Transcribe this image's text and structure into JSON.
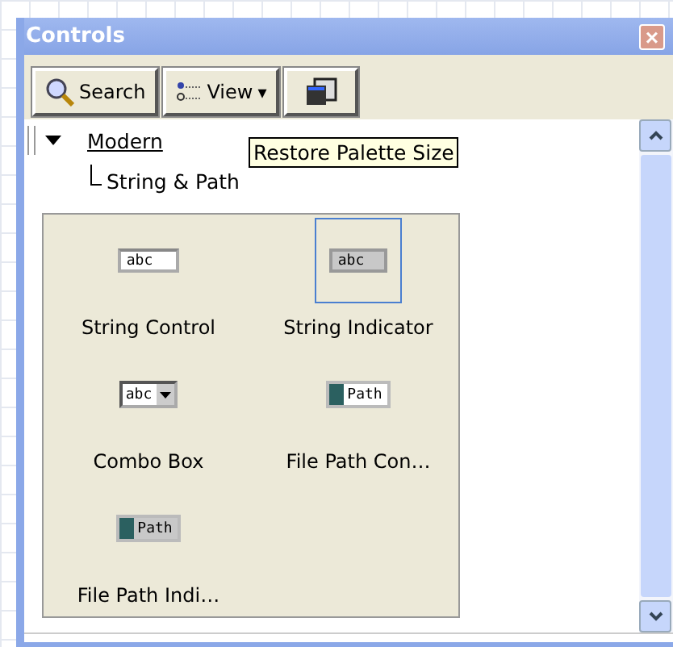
{
  "window": {
    "title": "Controls",
    "close": "×"
  },
  "toolbar": [
    {
      "kind": "search",
      "label": "Search"
    },
    {
      "kind": "view",
      "label": "View",
      "caret": "▾"
    },
    {
      "kind": "restore"
    }
  ],
  "tooltip": "Restore Palette Size",
  "tree": [
    {
      "label": "Modern",
      "expanded": true,
      "children": [
        {
          "label": "String & Path"
        }
      ]
    }
  ],
  "palette": [
    {
      "label": "String Control",
      "kind": "string-control",
      "icon_text": "abc",
      "selected": false
    },
    {
      "label": "String Indicator",
      "kind": "string-indicator",
      "icon_text": "abc",
      "selected": true
    },
    {
      "label": "Combo Box",
      "kind": "combo",
      "icon_text": "abc",
      "selected": false
    },
    {
      "label": "File Path Con…",
      "kind": "path-control",
      "icon_text": "Path",
      "selected": false
    },
    {
      "label": "File Path Indi…",
      "kind": "path-indicator",
      "icon_text": "Path",
      "selected": false
    }
  ]
}
